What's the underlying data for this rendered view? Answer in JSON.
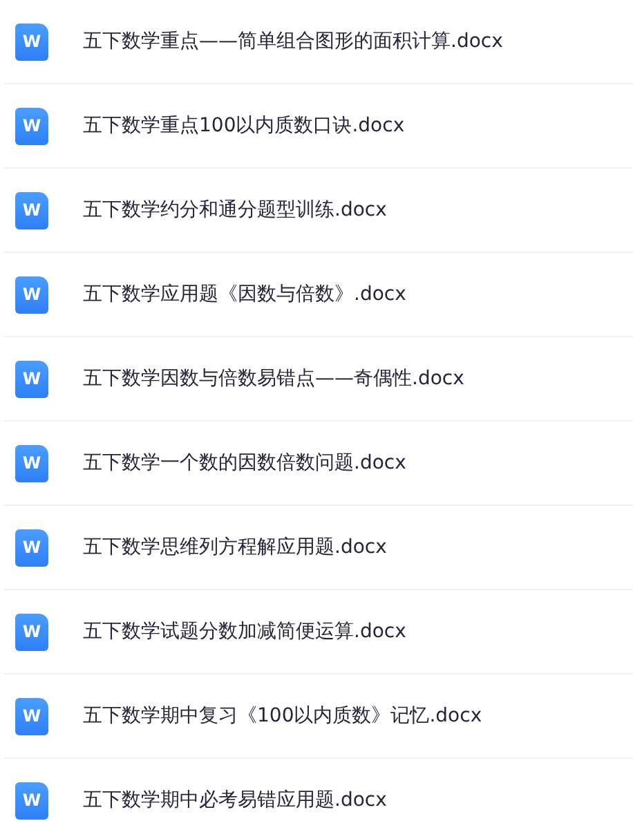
{
  "files": [
    {
      "icon_label": "W",
      "name": "五下数学重点——简单组合图形的面积计算.docx"
    },
    {
      "icon_label": "W",
      "name": "五下数学重点100以内质数口诀.docx"
    },
    {
      "icon_label": "W",
      "name": "五下数学约分和通分题型训练.docx"
    },
    {
      "icon_label": "W",
      "name": "五下数学应用题《因数与倍数》.docx"
    },
    {
      "icon_label": "W",
      "name": "五下数学因数与倍数易错点——奇偶性.docx"
    },
    {
      "icon_label": "W",
      "name": "五下数学一个数的因数倍数问题.docx"
    },
    {
      "icon_label": "W",
      "name": "五下数学思维列方程解应用题.docx"
    },
    {
      "icon_label": "W",
      "name": "五下数学试题分数加减简便运算.docx"
    },
    {
      "icon_label": "W",
      "name": "五下数学期中复习《100以内质数》记忆.docx"
    },
    {
      "icon_label": "W",
      "name": "五下数学期中必考易错应用题.docx"
    }
  ]
}
